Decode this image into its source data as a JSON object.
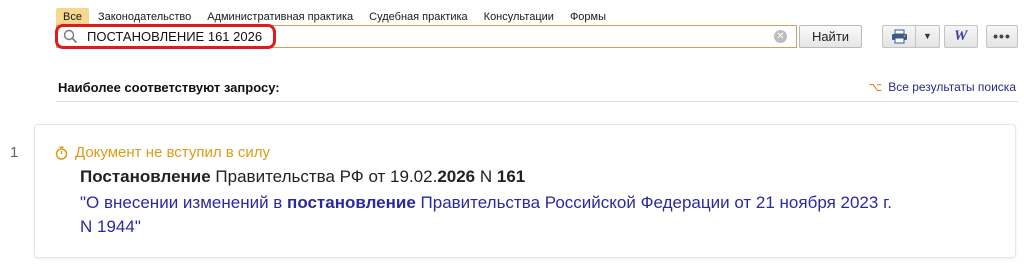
{
  "tabs": [
    {
      "label": "Все",
      "active": true
    },
    {
      "label": "Законодательство",
      "active": false
    },
    {
      "label": "Административная практика",
      "active": false
    },
    {
      "label": "Судебная практика",
      "active": false
    },
    {
      "label": "Консультации",
      "active": false
    },
    {
      "label": "Формы",
      "active": false
    }
  ],
  "search": {
    "value": "ПОСТАНОВЛЕНИЕ 161 2026",
    "find_label": "Найти",
    "highlight_color": "#e01b1b"
  },
  "toolbar": {
    "print_icon": "printer-icon",
    "dropdown_icon": "chevron-down-icon",
    "word_label": "W",
    "more_label": "•••"
  },
  "results": {
    "section_title": "Наиболее соответствуют запросу:",
    "all_results_label": "Все результаты поиска",
    "items": [
      {
        "number": "1",
        "status": "Документ не вступил в силу",
        "status_color": "#e09a14",
        "head_bold_1": "Постановление",
        "head_text_1": " Правительства РФ от 19.02.",
        "head_bold_2": "2026",
        "head_text_2": " N ",
        "head_bold_3": "161",
        "title_part_1": "\"О внесении изменений в ",
        "title_bold": "постановление",
        "title_part_2": " Правительства Российской Федерации от 21 ноября 2023 г. N 1944\"",
        "link_color": "#2a2aa0"
      }
    ]
  }
}
